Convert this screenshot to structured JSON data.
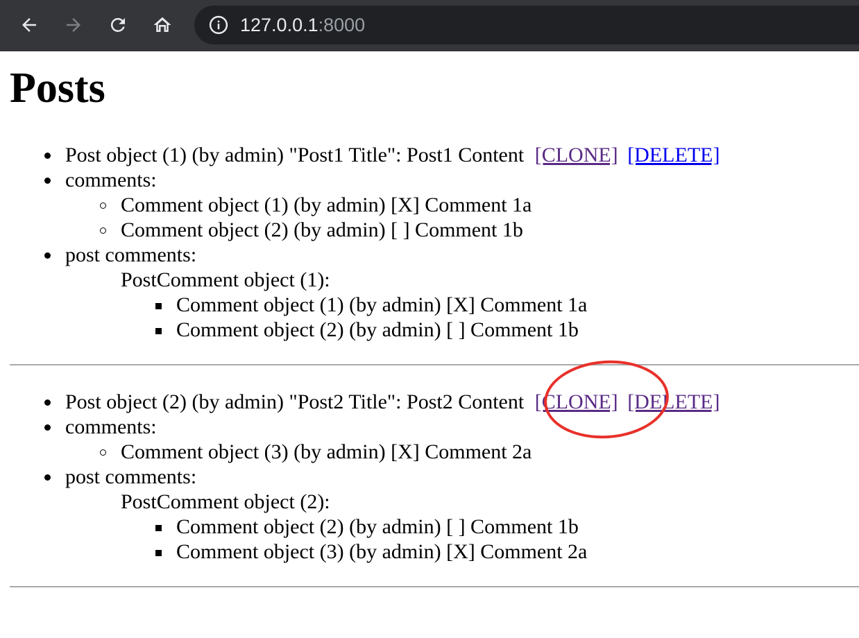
{
  "browser": {
    "url_host": "127.0.0.1",
    "url_port": ":8000"
  },
  "page_title": "Posts",
  "posts": [
    {
      "post_line": "Post object (1) (by admin) \"Post1 Title\": Post1 Content",
      "clone_label": "[CLONE]",
      "delete_label": "[DELETE]",
      "comments_label": "comments:",
      "comments": [
        "Comment object (1) (by admin) [X] Comment 1a",
        "Comment object (2) (by admin) [ ] Comment 1b"
      ],
      "post_comments_label": "post comments:",
      "postcomment_title": "PostComment object (1):",
      "postcomment_items": [
        "Comment object (1) (by admin) [X] Comment 1a",
        "Comment object (2) (by admin) [ ] Comment 1b"
      ]
    },
    {
      "post_line": "Post object (2) (by admin) \"Post2 Title\": Post2 Content",
      "clone_label": "[CLONE]",
      "delete_label": "[DELETE]",
      "comments_label": "comments:",
      "comments": [
        "Comment object (3) (by admin) [X] Comment 2a"
      ],
      "post_comments_label": "post comments:",
      "postcomment_title": "PostComment object (2):",
      "postcomment_items": [
        "Comment object (2) (by admin) [ ] Comment 1b",
        "Comment object (3) (by admin) [X] Comment 2a"
      ]
    }
  ],
  "colors": {
    "visited_link": "#5a2a86",
    "link": "#0000ee",
    "annotation_circle": "#e8312a"
  }
}
